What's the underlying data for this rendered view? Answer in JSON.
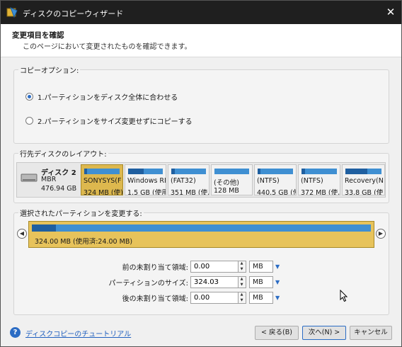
{
  "window": {
    "title": "ディスクのコピーウィザード",
    "close_glyph": "✕"
  },
  "header": {
    "title": "変更項目を確認",
    "description": "このページにおいて変更されたものを確認できます。"
  },
  "copy_options": {
    "legend": "コピーオプション:",
    "options": [
      {
        "label": "1.パーティションをディスク全体に合わせる",
        "selected": true
      },
      {
        "label": "2.パーティションをサイズ変更せずにコピーする",
        "selected": false
      }
    ]
  },
  "target_layout": {
    "legend": "行先ディスクのレイアウト:",
    "disk": {
      "name": "ディスク 2",
      "type": "MBR",
      "size": "476.94 GB"
    },
    "partitions": [
      {
        "name": "SONYSYS(F",
        "size": "324 MB (使)",
        "used_fraction": 0.07,
        "selected": true
      },
      {
        "name": "Windows RI",
        "size": "1.5 GB (使用",
        "used_fraction": 0.45,
        "selected": false
      },
      {
        "name": "(FAT32)",
        "size": "351 MB (使,",
        "used_fraction": 0.1,
        "selected": false
      },
      {
        "name": "(その他)",
        "size": "128 MB",
        "used_fraction": 0.0,
        "selected": false
      },
      {
        "name": "(NTFS)",
        "size": "440.5 GB (使",
        "used_fraction": 0.08,
        "selected": false
      },
      {
        "name": "(NTFS)",
        "size": "372 MB (使,",
        "used_fraction": 0.1,
        "selected": false
      },
      {
        "name": "Recovery(N",
        "size": "33.8 GB (使",
        "used_fraction": 0.6,
        "selected": false
      }
    ]
  },
  "resize": {
    "legend": "選択されたパーティションを変更する:",
    "partition_label": "324.00 MB (使用済:24.00 MB)",
    "used_fraction": 0.07,
    "fields": [
      {
        "label": "前の未割り当て領域:",
        "value": "0.00",
        "unit": "MB"
      },
      {
        "label": "パーティションのサイズ:",
        "value": "324.03",
        "unit": "MB"
      },
      {
        "label": "後の未割り当て領域:",
        "value": "0.00",
        "unit": "MB"
      }
    ]
  },
  "footer": {
    "help_label": "ディスクコピーのチュートリアル",
    "back_label": "< 戻る(B)",
    "next_label": "次へ(N) >",
    "cancel_label": "キャンセル"
  },
  "colors": {
    "selected_partition": "#ddb84e",
    "partition_bar": "#3f8fd2",
    "partition_used": "#1f5fa0",
    "link": "#1f5fbf",
    "titlebar": "#1f1f1f"
  }
}
